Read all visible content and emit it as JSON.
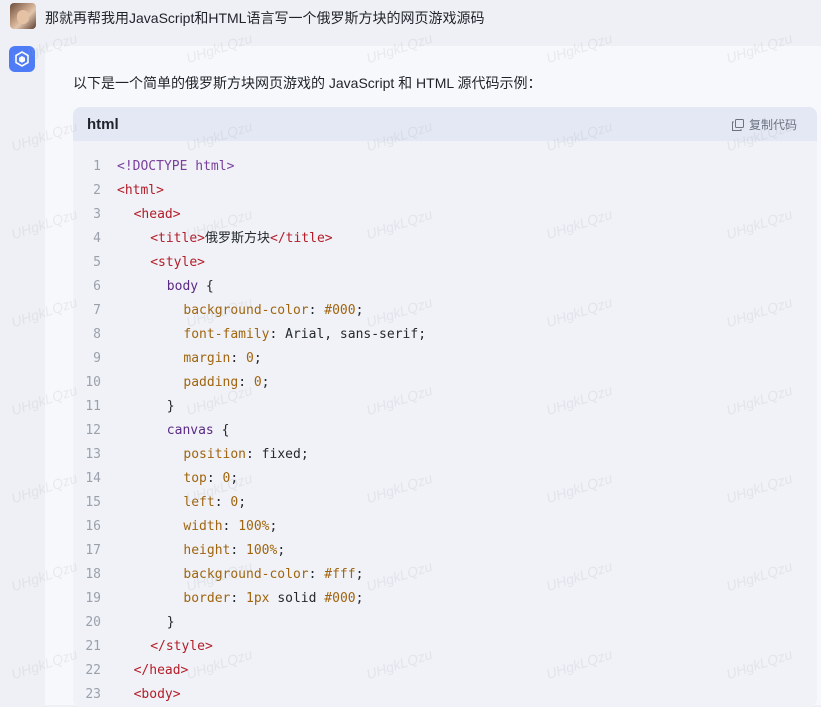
{
  "user": {
    "message": "那就再帮我用JavaScript和HTML语言写一个俄罗斯方块的网页游戏源码"
  },
  "assistant": {
    "intro": "以下是一个简单的俄罗斯方块网页游戏的 JavaScript 和 HTML 源代码示例："
  },
  "code_block": {
    "language": "html",
    "copy_label": "复制代码",
    "lines": [
      {
        "n": "1",
        "indent": 0,
        "parts": [
          [
            "doc",
            "<!DOCTYPE html>"
          ]
        ]
      },
      {
        "n": "2",
        "indent": 0,
        "parts": [
          [
            "tag",
            "<html>"
          ]
        ]
      },
      {
        "n": "3",
        "indent": 1,
        "parts": [
          [
            "tag",
            "<head>"
          ]
        ]
      },
      {
        "n": "4",
        "indent": 2,
        "parts": [
          [
            "tag",
            "<title>"
          ],
          [
            "txt",
            "俄罗斯方块"
          ],
          [
            "tag",
            "</title>"
          ]
        ]
      },
      {
        "n": "5",
        "indent": 2,
        "parts": [
          [
            "tag",
            "<style>"
          ]
        ]
      },
      {
        "n": "6",
        "indent": 3,
        "parts": [
          [
            "sel",
            "body"
          ],
          [
            "punc",
            " {"
          ]
        ]
      },
      {
        "n": "7",
        "indent": 4,
        "parts": [
          [
            "prop",
            "background-color"
          ],
          [
            "punc",
            ": "
          ],
          [
            "num",
            "#000"
          ],
          [
            "punc",
            ";"
          ]
        ]
      },
      {
        "n": "8",
        "indent": 4,
        "parts": [
          [
            "prop",
            "font-family"
          ],
          [
            "punc",
            ": "
          ],
          [
            "val",
            "Arial, sans-serif"
          ],
          [
            "punc",
            ";"
          ]
        ]
      },
      {
        "n": "9",
        "indent": 4,
        "parts": [
          [
            "prop",
            "margin"
          ],
          [
            "punc",
            ": "
          ],
          [
            "num",
            "0"
          ],
          [
            "punc",
            ";"
          ]
        ]
      },
      {
        "n": "10",
        "indent": 4,
        "parts": [
          [
            "prop",
            "padding"
          ],
          [
            "punc",
            ": "
          ],
          [
            "num",
            "0"
          ],
          [
            "punc",
            ";"
          ]
        ]
      },
      {
        "n": "11",
        "indent": 3,
        "parts": [
          [
            "punc",
            "}"
          ]
        ]
      },
      {
        "n": "12",
        "indent": 3,
        "parts": [
          [
            "sel",
            "canvas"
          ],
          [
            "punc",
            " {"
          ]
        ]
      },
      {
        "n": "13",
        "indent": 4,
        "parts": [
          [
            "prop",
            "position"
          ],
          [
            "punc",
            ": "
          ],
          [
            "val",
            "fixed"
          ],
          [
            "punc",
            ";"
          ]
        ]
      },
      {
        "n": "14",
        "indent": 4,
        "parts": [
          [
            "prop",
            "top"
          ],
          [
            "punc",
            ": "
          ],
          [
            "num",
            "0"
          ],
          [
            "punc",
            ";"
          ]
        ]
      },
      {
        "n": "15",
        "indent": 4,
        "parts": [
          [
            "prop",
            "left"
          ],
          [
            "punc",
            ": "
          ],
          [
            "num",
            "0"
          ],
          [
            "punc",
            ";"
          ]
        ]
      },
      {
        "n": "16",
        "indent": 4,
        "parts": [
          [
            "prop",
            "width"
          ],
          [
            "punc",
            ": "
          ],
          [
            "num",
            "100%"
          ],
          [
            "punc",
            ";"
          ]
        ]
      },
      {
        "n": "17",
        "indent": 4,
        "parts": [
          [
            "prop",
            "height"
          ],
          [
            "punc",
            ": "
          ],
          [
            "num",
            "100%"
          ],
          [
            "punc",
            ";"
          ]
        ]
      },
      {
        "n": "18",
        "indent": 4,
        "parts": [
          [
            "prop",
            "background-color"
          ],
          [
            "punc",
            ": "
          ],
          [
            "num",
            "#fff"
          ],
          [
            "punc",
            ";"
          ]
        ]
      },
      {
        "n": "19",
        "indent": 4,
        "parts": [
          [
            "prop",
            "border"
          ],
          [
            "punc",
            ": "
          ],
          [
            "num",
            "1px"
          ],
          [
            "val",
            " solid "
          ],
          [
            "num",
            "#000"
          ],
          [
            "punc",
            ";"
          ]
        ]
      },
      {
        "n": "20",
        "indent": 3,
        "parts": [
          [
            "punc",
            "}"
          ]
        ]
      },
      {
        "n": "21",
        "indent": 2,
        "parts": [
          [
            "tag",
            "</style>"
          ]
        ]
      },
      {
        "n": "22",
        "indent": 1,
        "parts": [
          [
            "tag",
            "</head>"
          ]
        ]
      },
      {
        "n": "23",
        "indent": 1,
        "parts": [
          [
            "tag",
            "<body>"
          ]
        ]
      }
    ]
  },
  "watermark": "UHgkLQzu",
  "colors": {
    "accent": "#4d7cf6",
    "tag": "#b31d28",
    "property": "#a0650f",
    "selector": "#5b2a86",
    "doctype": "#7a3e9d"
  },
  "icons": {
    "bot": "cube-logo-icon",
    "copy": "copy-icon"
  }
}
